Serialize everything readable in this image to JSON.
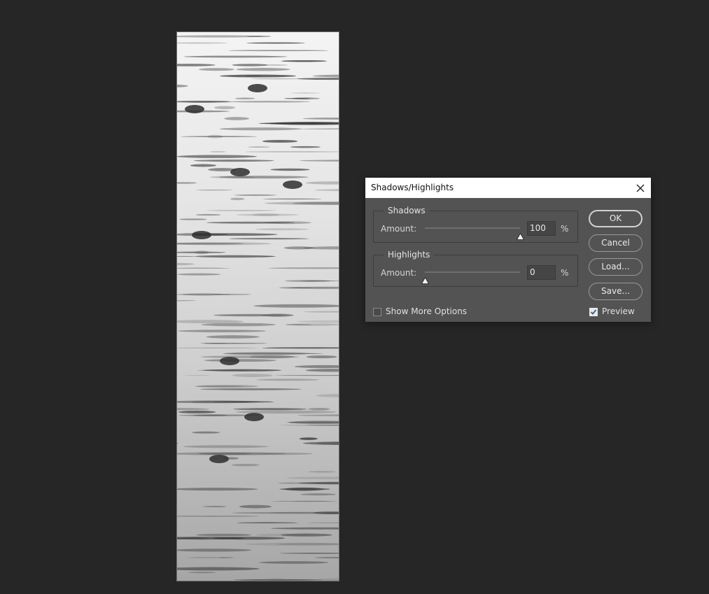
{
  "dialog": {
    "title": "Shadows/Highlights",
    "shadows": {
      "legend": "Shadows",
      "amount_label": "Amount:",
      "amount_value": "100",
      "unit": "%",
      "slider_fraction": 1.0
    },
    "highlights": {
      "legend": "Highlights",
      "amount_label": "Amount:",
      "amount_value": "0",
      "unit": "%",
      "slider_fraction": 0.0
    },
    "buttons": {
      "ok": "OK",
      "cancel": "Cancel",
      "load": "Load...",
      "save": "Save..."
    },
    "show_more_options": {
      "label": "Show More Options",
      "checked": false
    },
    "preview": {
      "label": "Preview",
      "checked": true
    }
  },
  "colors": {
    "app_background": "#262626",
    "dialog_background": "#535353",
    "titlebar_background": "#ffffff"
  },
  "icons": {
    "close": "close-icon",
    "slider_thumb": "triangle-slider-thumb-icon",
    "checkmark": "checkmark-icon"
  }
}
